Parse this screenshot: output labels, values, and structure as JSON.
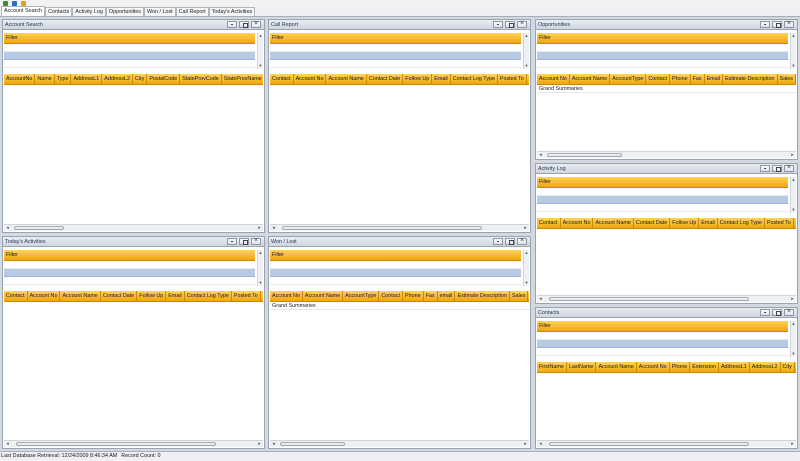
{
  "tabs": [
    {
      "label": "Account Search",
      "active": true
    },
    {
      "label": "Contacts"
    },
    {
      "label": "Activity Log"
    },
    {
      "label": "Opportunities"
    },
    {
      "label": "Won / Lost"
    },
    {
      "label": "Call Report"
    },
    {
      "label": "Today's Activities"
    }
  ],
  "panels": {
    "account_search": {
      "title": "Account Search",
      "filter": "Filter",
      "columns": [
        "AccountNo",
        "Name",
        "Type",
        "AddressL1",
        "AddressL2",
        "City",
        "PostalCode",
        "StateProvCode",
        "StateProvName"
      ]
    },
    "call_report": {
      "title": "Call Report",
      "filter": "Filter",
      "columns": [
        "Contact",
        "Account No",
        "Account Name",
        "Contact Date",
        "Follow Up",
        "Email",
        "Contact Log Type",
        "Posted To"
      ]
    },
    "opportunities": {
      "title": "Opportunities",
      "filter": "Filter",
      "columns": [
        "Account No",
        "Account Name",
        "AccountType",
        "Contact",
        "Phone",
        "Fax",
        "Email",
        "Estimate Description",
        "Sales"
      ],
      "summary": "Grand Summaries"
    },
    "activity_log": {
      "title": "Activity Log",
      "filter": "Filter",
      "columns": [
        "Contact",
        "Account No",
        "Account Name",
        "Contact Date",
        "Follow Up",
        "Email",
        "Contact Log Type",
        "Posted To"
      ]
    },
    "todays_activities": {
      "title": "Today's Activities",
      "filter": "Filter",
      "columns": [
        "Contact",
        "Account No",
        "Account Name",
        "Contact Date",
        "Follow Up",
        "Email",
        "Contact Log Type",
        "Posted To"
      ]
    },
    "won_lost": {
      "title": "Won / Lost",
      "filter": "Filter",
      "columns": [
        "Account No",
        "Account Name",
        "AccountType",
        "Contact",
        "Phone",
        "Fax",
        "email",
        "Estimate Description",
        "Sales"
      ],
      "summary": "Grand Summaries"
    },
    "contacts": {
      "title": "Contacts",
      "filter": "Filter",
      "columns": [
        "FirstName",
        "LastName",
        "Account Name",
        "Account No",
        "Phone",
        "Extension",
        "AddressL1",
        "AddressL2",
        "City"
      ]
    }
  },
  "status": {
    "retrieval": "Last Database Retrieval: 12/24/2009 8:46:34 AM",
    "record_count": "Record Count: 0"
  },
  "colors": {
    "header_gold": "#f3a50f",
    "selected_row": "#b7c9e4",
    "panel_title": "#cfd5df"
  }
}
